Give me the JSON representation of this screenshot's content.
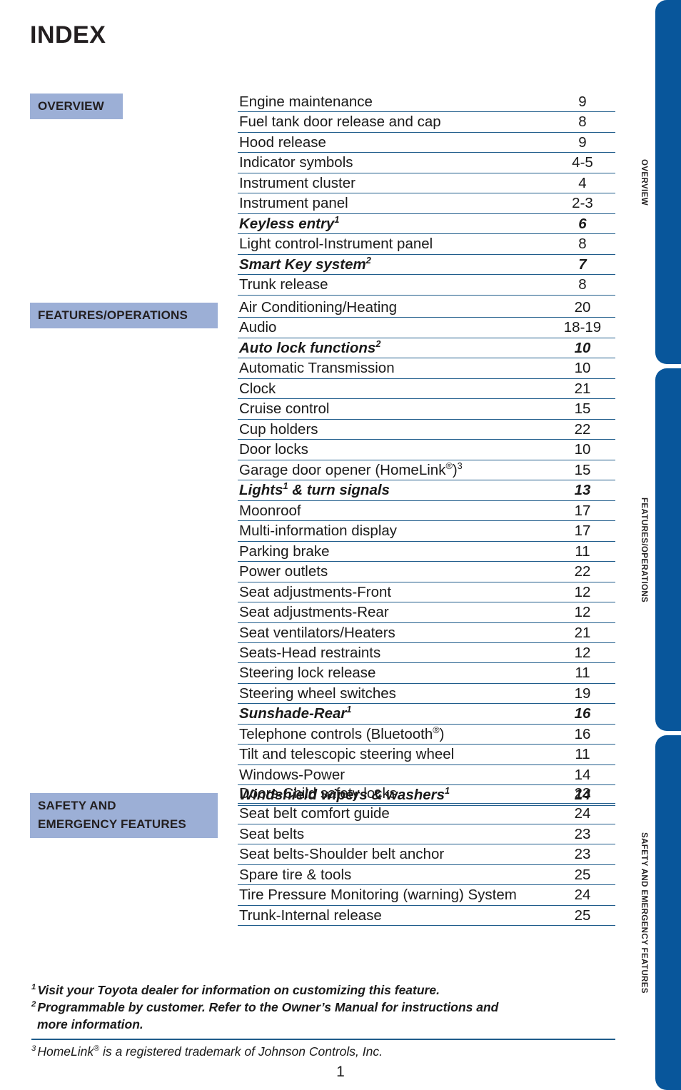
{
  "document": {
    "title": "INDEX",
    "page_number": "1"
  },
  "colors": {
    "tab_blue": "#08569b",
    "chip_blue": "#9cafd6",
    "rule_blue": "#1f5c8b",
    "text": "#1a1a1a"
  },
  "side_tabs": [
    {
      "label": "OVERVIEW"
    },
    {
      "label": "FEATURES/OPERATIONS"
    },
    {
      "label": "SAFETY AND EMERGENCY FEATURES"
    }
  ],
  "sections": [
    {
      "chip_label": "OVERVIEW",
      "chip_lines": [
        "OVERVIEW"
      ],
      "entries": [
        {
          "title": "Engine maintenance",
          "page": "9",
          "emphasis": false
        },
        {
          "title": "Fuel tank door release and cap",
          "page": "8",
          "emphasis": false
        },
        {
          "title": "Hood release",
          "page": "9",
          "emphasis": false
        },
        {
          "title": "Indicator symbols",
          "page": "4-5",
          "emphasis": false
        },
        {
          "title": "Instrument cluster",
          "page": "4",
          "emphasis": false
        },
        {
          "title": "Instrument panel",
          "page": "2-3",
          "emphasis": false
        },
        {
          "title": "Keyless entry",
          "footnote": "1",
          "page": "6",
          "emphasis": true
        },
        {
          "title": "Light control-Instrument panel",
          "page": "8",
          "emphasis": false
        },
        {
          "title": "Smart Key system",
          "footnote": "2",
          "page": "7",
          "emphasis": true
        },
        {
          "title": "Trunk release",
          "page": "8",
          "emphasis": false
        }
      ]
    },
    {
      "chip_label": "FEATURES/OPERATIONS",
      "chip_lines": [
        "FEATURES/OPERATIONS"
      ],
      "entries": [
        {
          "title": "Air Conditioning/Heating",
          "page": "20",
          "emphasis": false
        },
        {
          "title": "Audio",
          "page": "18-19",
          "emphasis": false
        },
        {
          "title": "Auto lock functions",
          "footnote": "2",
          "page": "10",
          "emphasis": true
        },
        {
          "title": "Automatic Transmission",
          "page": "10",
          "emphasis": false
        },
        {
          "title": "Clock",
          "page": "21",
          "emphasis": false
        },
        {
          "title": "Cruise control",
          "page": "15",
          "emphasis": false
        },
        {
          "title": "Cup holders",
          "page": "22",
          "emphasis": false
        },
        {
          "title": "Door locks",
          "page": "10",
          "emphasis": false
        },
        {
          "title": "Garage door opener (HomeLink®)",
          "footnote": "3",
          "page": "15",
          "emphasis": false,
          "registered": true
        },
        {
          "title": "Lights¹ & turn signals",
          "page": "13",
          "emphasis": true
        },
        {
          "title": "Moonroof",
          "page": "17",
          "emphasis": false
        },
        {
          "title": "Multi-information display",
          "page": "17",
          "emphasis": false
        },
        {
          "title": "Parking brake",
          "page": "11",
          "emphasis": false
        },
        {
          "title": "Power outlets",
          "page": "22",
          "emphasis": false
        },
        {
          "title": "Seat adjustments-Front",
          "page": "12",
          "emphasis": false
        },
        {
          "title": "Seat adjustments-Rear",
          "page": "12",
          "emphasis": false
        },
        {
          "title": "Seat ventilators/Heaters",
          "page": "21",
          "emphasis": false
        },
        {
          "title": "Seats-Head restraints",
          "page": "12",
          "emphasis": false
        },
        {
          "title": "Steering lock release",
          "page": "11",
          "emphasis": false
        },
        {
          "title": "Steering wheel switches",
          "page": "19",
          "emphasis": false
        },
        {
          "title": "Sunshade-Rear",
          "footnote": "1",
          "page": "16",
          "emphasis": true
        },
        {
          "title": "Telephone controls (Bluetooth®)",
          "page": "16",
          "emphasis": false
        },
        {
          "title": "Tilt and telescopic steering wheel",
          "page": "11",
          "emphasis": false
        },
        {
          "title": "Windows-Power",
          "page": "14",
          "emphasis": false
        },
        {
          "title": "Windshield wipers & washers",
          "footnote": "1",
          "page": "14",
          "emphasis": true
        }
      ]
    },
    {
      "chip_label": "SAFETY AND EMERGENCY FEATURES",
      "chip_lines": [
        "SAFETY AND",
        "EMERGENCY FEATURES"
      ],
      "entries": [
        {
          "title": "Doors-Child safety locks",
          "page": "23",
          "emphasis": false
        },
        {
          "title": "Seat belt comfort guide",
          "page": "24",
          "emphasis": false
        },
        {
          "title": "Seat belts",
          "page": "23",
          "emphasis": false
        },
        {
          "title": "Seat belts-Shoulder belt anchor",
          "page": "23",
          "emphasis": false
        },
        {
          "title": "Spare tire & tools",
          "page": "25",
          "emphasis": false
        },
        {
          "title": "Tire Pressure Monitoring (warning) System",
          "page": "24",
          "emphasis": false
        },
        {
          "title": "Trunk-Internal release",
          "page": "25",
          "emphasis": false
        }
      ]
    }
  ],
  "footnotes": [
    {
      "marker": "1",
      "text": "Visit your Toyota dealer for information on customizing this feature.",
      "bold": true
    },
    {
      "marker": "2",
      "text": "Programmable by customer. Refer to the Owner’s Manual for instructions and",
      "text_line2": "more information.",
      "bold": true
    },
    {
      "marker": "3",
      "text": "HomeLink® is a registered trademark of Johnson Controls, Inc.",
      "bold": false
    }
  ]
}
